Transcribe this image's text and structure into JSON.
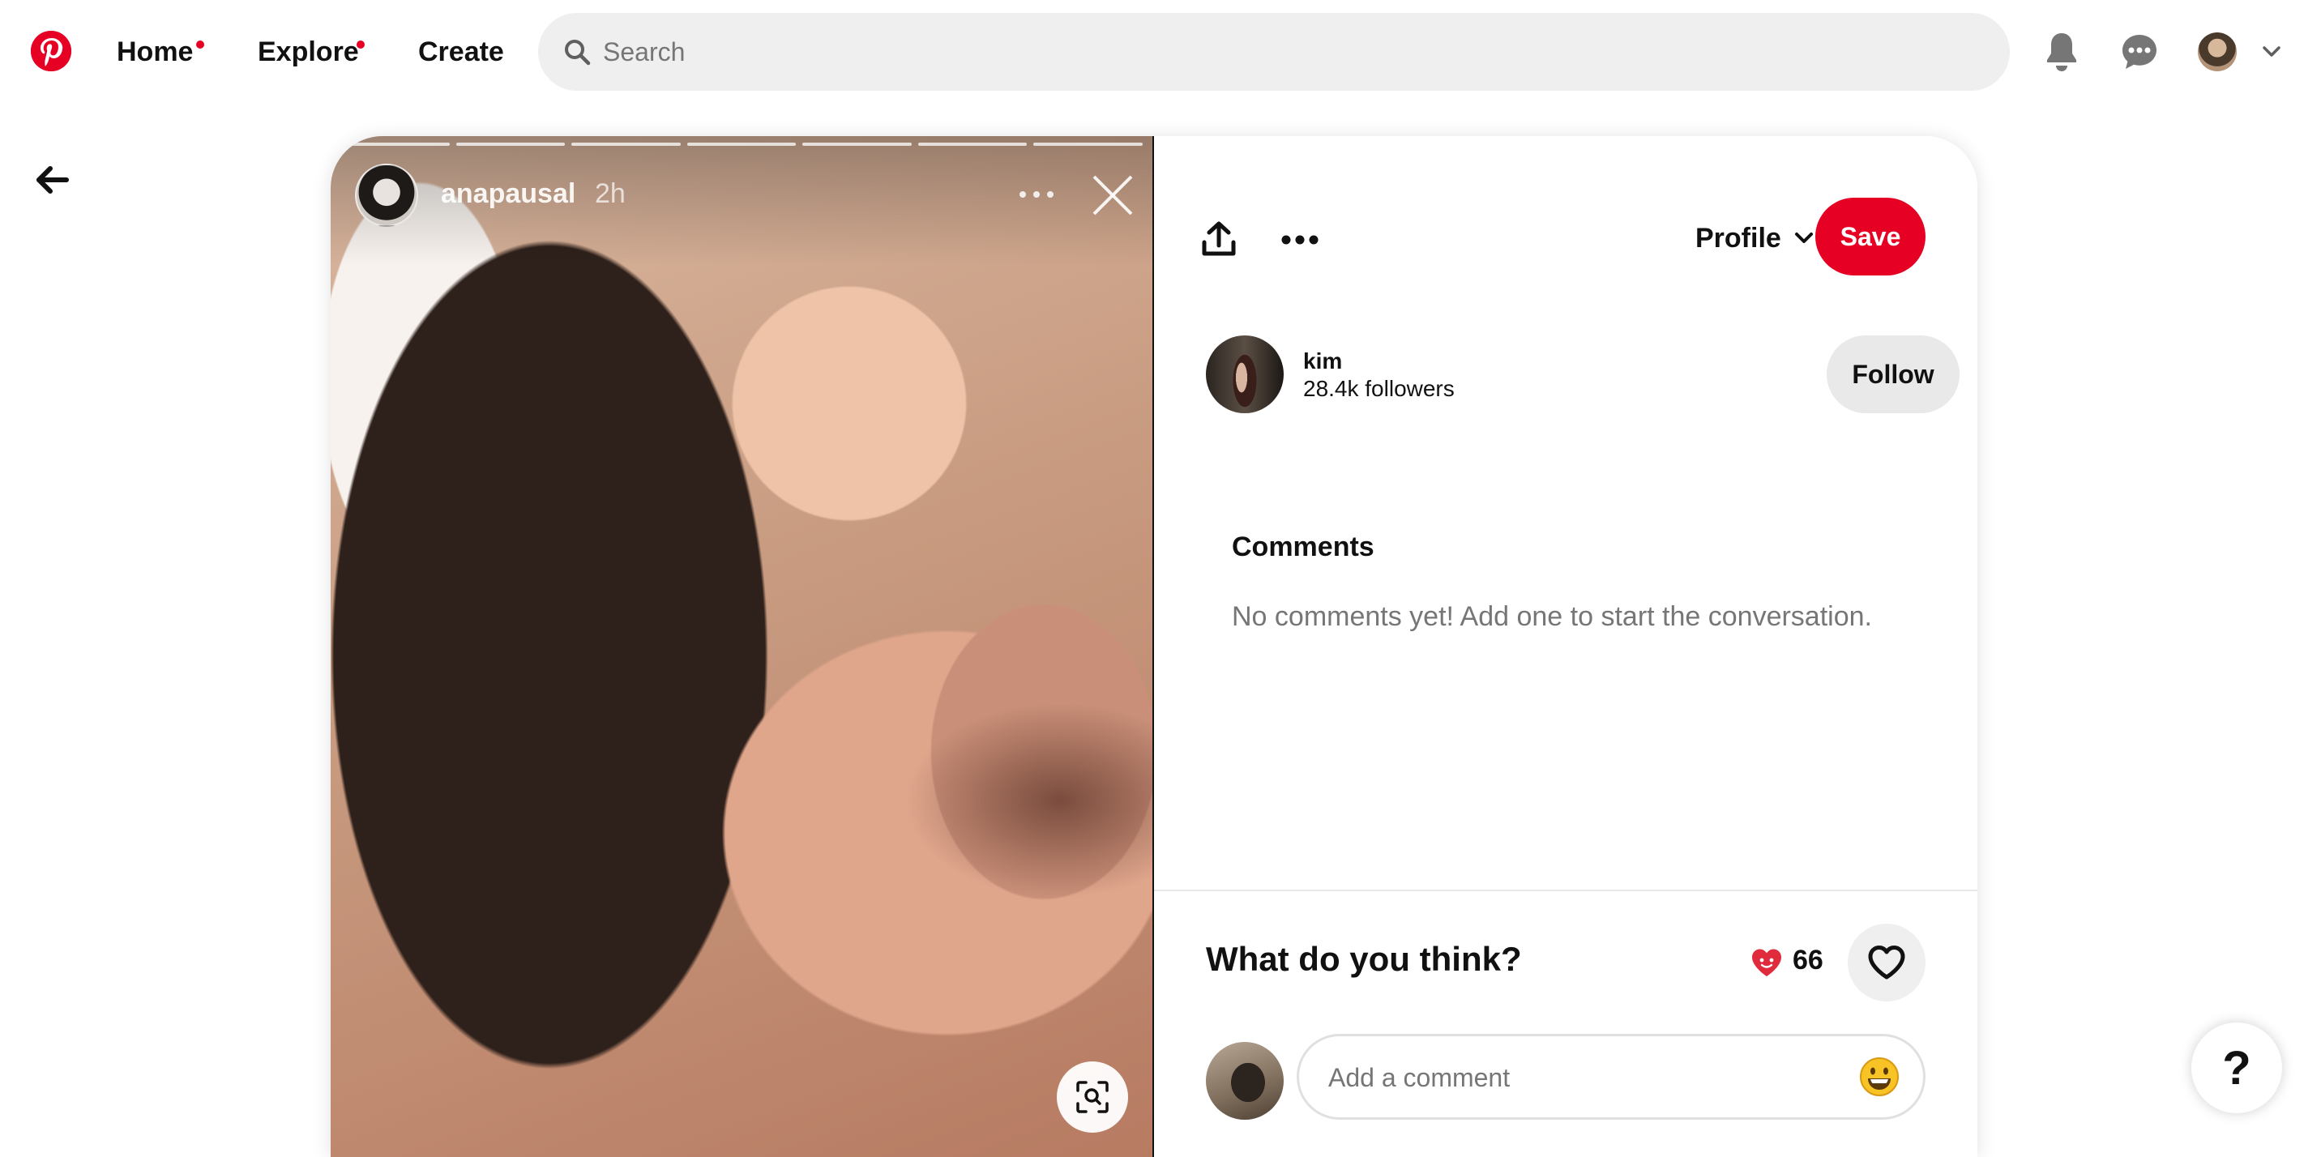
{
  "nav": {
    "home": "Home",
    "explore": "Explore",
    "create": "Create",
    "search_placeholder": "Search",
    "logo_icon": "pinterest-logo",
    "notifications_icon": "bell-icon",
    "messages_icon": "chat-bubble-icon",
    "accent": "#e60023"
  },
  "story": {
    "username": "anapausal",
    "time": "2h",
    "segments": 7
  },
  "pin": {
    "profile_label": "Profile",
    "save_label": "Save",
    "creator": {
      "name": "kim",
      "followers": "28.4k followers",
      "follow_label": "Follow"
    },
    "comments": {
      "title": "Comments",
      "empty": "No comments yet! Add one to start the conversation."
    },
    "reactions": {
      "prompt": "What do you think?",
      "count": "66"
    },
    "comment_input": {
      "placeholder": "Add a comment"
    }
  },
  "help": {
    "label": "?"
  }
}
